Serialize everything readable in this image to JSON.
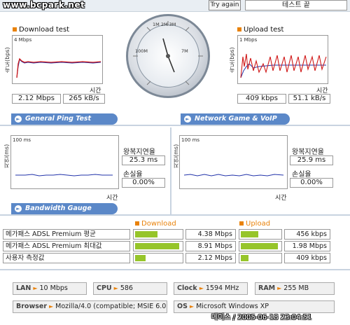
{
  "header": {
    "site_watermark": "www.bcpark.net",
    "try_again": "Try again",
    "test_end": "테스트 끝"
  },
  "download": {
    "title": "Download test",
    "ylabel": "속도(bps)",
    "scale": "4 Mbps",
    "xlabel": "시간",
    "speed": "2.12 Mbps",
    "rate": "265 kB/s"
  },
  "upload": {
    "title": "Upload test",
    "ylabel": "속도(bps)",
    "scale": "1 Mbps",
    "xlabel": "시간",
    "speed": "409 kbps",
    "rate": "51.1 kB/s"
  },
  "gauge": {
    "scale_labels": [
      "1M",
      "2M",
      "3M",
      "4M",
      "5M",
      "6M",
      "7M",
      "8M",
      "10M",
      "20M",
      "30M",
      "50M",
      "100M"
    ]
  },
  "ping": {
    "title": "General Ping Test",
    "ylabel": "지연(ms)",
    "scale": "100 ms",
    "xlabel": "시간",
    "rtt_label": "왕복지연율",
    "rtt": "25.3 ms",
    "loss_label": "손실율",
    "loss": "0.00%"
  },
  "game": {
    "title": "Network Game & VoIP Test",
    "ylabel": "지연(ms)",
    "scale": "100 ms",
    "xlabel": "시간",
    "rtt_label": "왕복지연율",
    "rtt": "25.9 ms",
    "loss_label": "손실율",
    "loss": "0.00%"
  },
  "bandwidth": {
    "title": "Bandwidth Gauge",
    "download_header": "Download",
    "upload_header": "Upload",
    "rows": [
      {
        "label": "메가패스 ADSL Premium 평균",
        "down": "4.38 Mbps",
        "down_pct": 0.48,
        "up": "456 kbps",
        "up_pct": 0.45
      },
      {
        "label": "메가패스 ADSL Premium 최대값",
        "down": "8.91 Mbps",
        "down_pct": 0.96,
        "up": "1.98 Mbps",
        "up_pct": 0.94
      },
      {
        "label": "사용자 측정값",
        "down": "2.12 Mbps",
        "down_pct": 0.23,
        "up": "409 kbps",
        "up_pct": 0.2
      }
    ]
  },
  "system": {
    "lan_key": "LAN",
    "lan": "10 Mbps",
    "cpu_key": "CPU",
    "cpu": "586",
    "clock_key": "Clock",
    "clock": "1594 MHz",
    "ram_key": "RAM",
    "ram": "255 MB",
    "browser_key": "Browser",
    "browser": "Mozilla/4.0 (compatible; MSIE 6.0",
    "os_key": "OS",
    "os": "Microsoft Windows XP"
  },
  "stamp": "메이스 / 2005-06-18 23:04:51",
  "colors": {
    "accent_orange": "#e9820a",
    "pill_blue": "#5b88c8",
    "bar_green": "#96c52a",
    "plot_red": "#d01818",
    "plot_blue": "#2233aa"
  }
}
